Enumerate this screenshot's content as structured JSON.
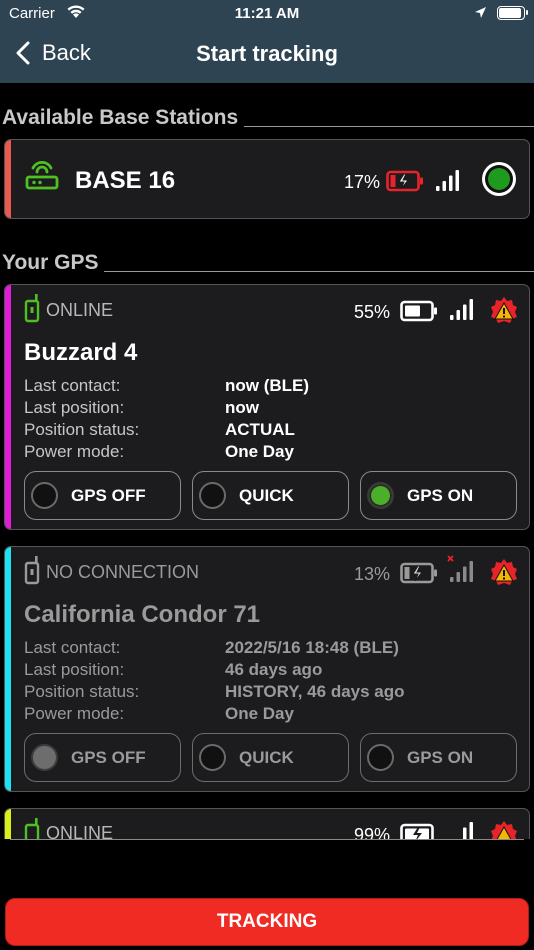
{
  "status_bar": {
    "carrier": "Carrier",
    "time": "11:21 AM"
  },
  "nav": {
    "back_label": "Back",
    "title": "Start tracking"
  },
  "sections": {
    "base_stations": "Available Base Stations",
    "your_gps": "Your GPS"
  },
  "base_station": {
    "name": "BASE  16",
    "battery_percent": "17%",
    "battery_level": 0.17,
    "stripe_color": "#e85a4f",
    "status_color": "#1e9a1e"
  },
  "gps_units": [
    {
      "connection": "ONLINE",
      "name": "Buzzard 4",
      "battery_percent": "55%",
      "stripe_color": "#e21bd7",
      "rows": [
        {
          "label": "Last contact:",
          "value": "now (BLE)"
        },
        {
          "label": "Last position:",
          "value": "now"
        },
        {
          "label": "Position status:",
          "value": "ACTUAL"
        },
        {
          "label": "Power mode:",
          "value": "One Day"
        }
      ],
      "buttons": [
        {
          "label": "GPS OFF"
        },
        {
          "label": "QUICK"
        },
        {
          "label": "GPS ON"
        }
      ],
      "selected": "GPS ON"
    },
    {
      "connection": "NO CONNECTION",
      "name": "California Condor 71",
      "battery_percent": "13%",
      "stripe_color": "#1ee0f0",
      "rows": [
        {
          "label": "Last contact:",
          "value": "2022/5/16 18:48 (BLE)"
        },
        {
          "label": "Last position:",
          "value": "46 days ago"
        },
        {
          "label": "Position status:",
          "value": "HISTORY, 46 days ago"
        },
        {
          "label": "Power mode:",
          "value": "One Day"
        }
      ],
      "buttons": [
        {
          "label": "GPS OFF"
        },
        {
          "label": "QUICK"
        },
        {
          "label": "GPS ON"
        }
      ],
      "selected": "GPS OFF"
    },
    {
      "connection": "ONLINE",
      "battery_percent": "99%",
      "stripe_color": "#d7ef1a"
    }
  ],
  "tracking_button": "TRACKING"
}
